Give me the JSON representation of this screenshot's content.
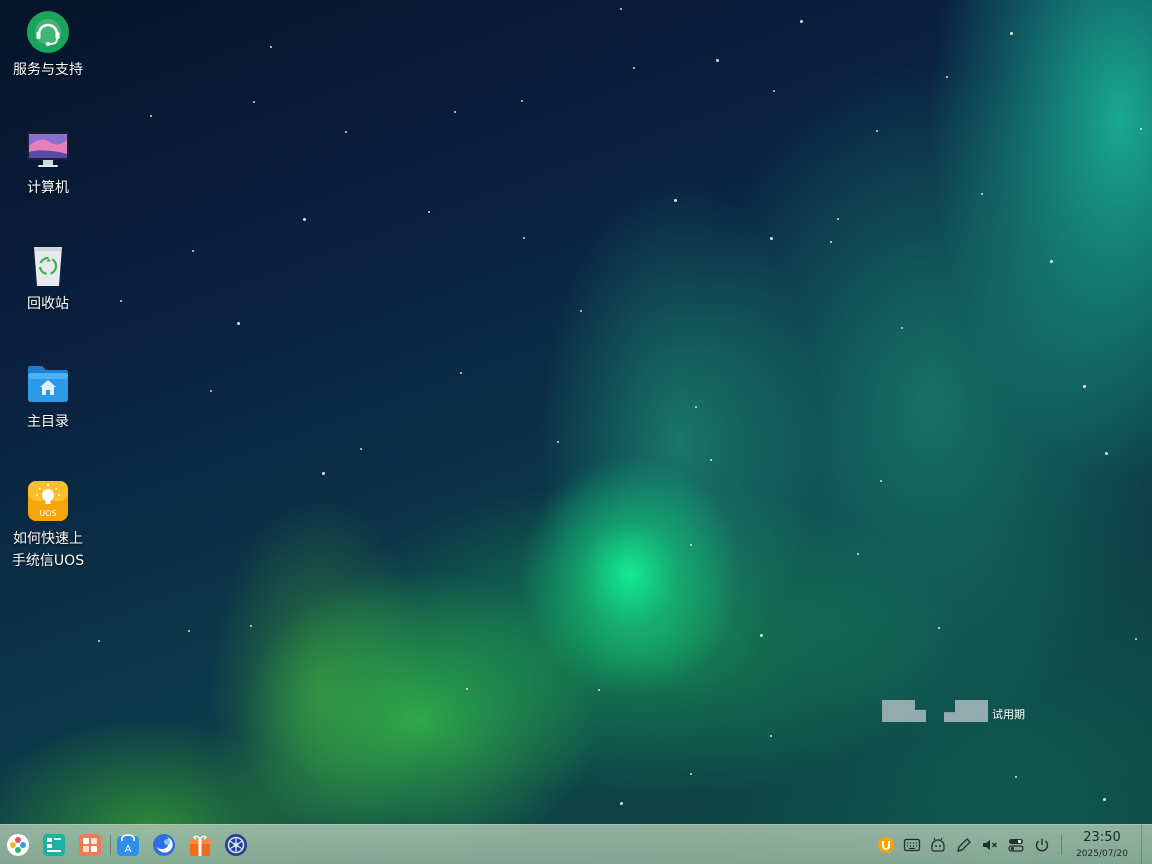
{
  "desktop": {
    "icons": [
      {
        "label": "服务与支持",
        "icon": "service-support-icon"
      },
      {
        "label": "计算机",
        "icon": "computer-icon"
      },
      {
        "label": "回收站",
        "icon": "trash-icon"
      },
      {
        "label": "主目录",
        "icon": "home-folder-icon"
      },
      {
        "label": "如何快速上",
        "label2": "手统信UOS",
        "icon": "uos-guide-icon"
      }
    ],
    "watermark": {
      "text": "试用期"
    }
  },
  "taskbar": {
    "apps": [
      {
        "name": "launcher-icon"
      },
      {
        "name": "multitask-view-icon"
      },
      {
        "name": "workspace-icon"
      },
      {
        "name": "app-store-icon"
      },
      {
        "name": "browser-icon"
      },
      {
        "name": "gift-box-icon"
      },
      {
        "name": "control-center-icon"
      }
    ],
    "tray": [
      {
        "name": "uos-id-icon"
      },
      {
        "name": "keyboard-icon"
      },
      {
        "name": "assistant-icon"
      },
      {
        "name": "pen-icon"
      },
      {
        "name": "volume-muted-icon"
      },
      {
        "name": "control-toggle-icon"
      },
      {
        "name": "power-icon"
      }
    ],
    "clock": {
      "time": "23:50",
      "date": "2025/07/20"
    }
  },
  "colors": {
    "taskbar_bg": "#a7c4b2",
    "support_green": "#1aa55a",
    "folder_blue": "#2a9ae8",
    "uos_orange": "#f5a50a"
  }
}
